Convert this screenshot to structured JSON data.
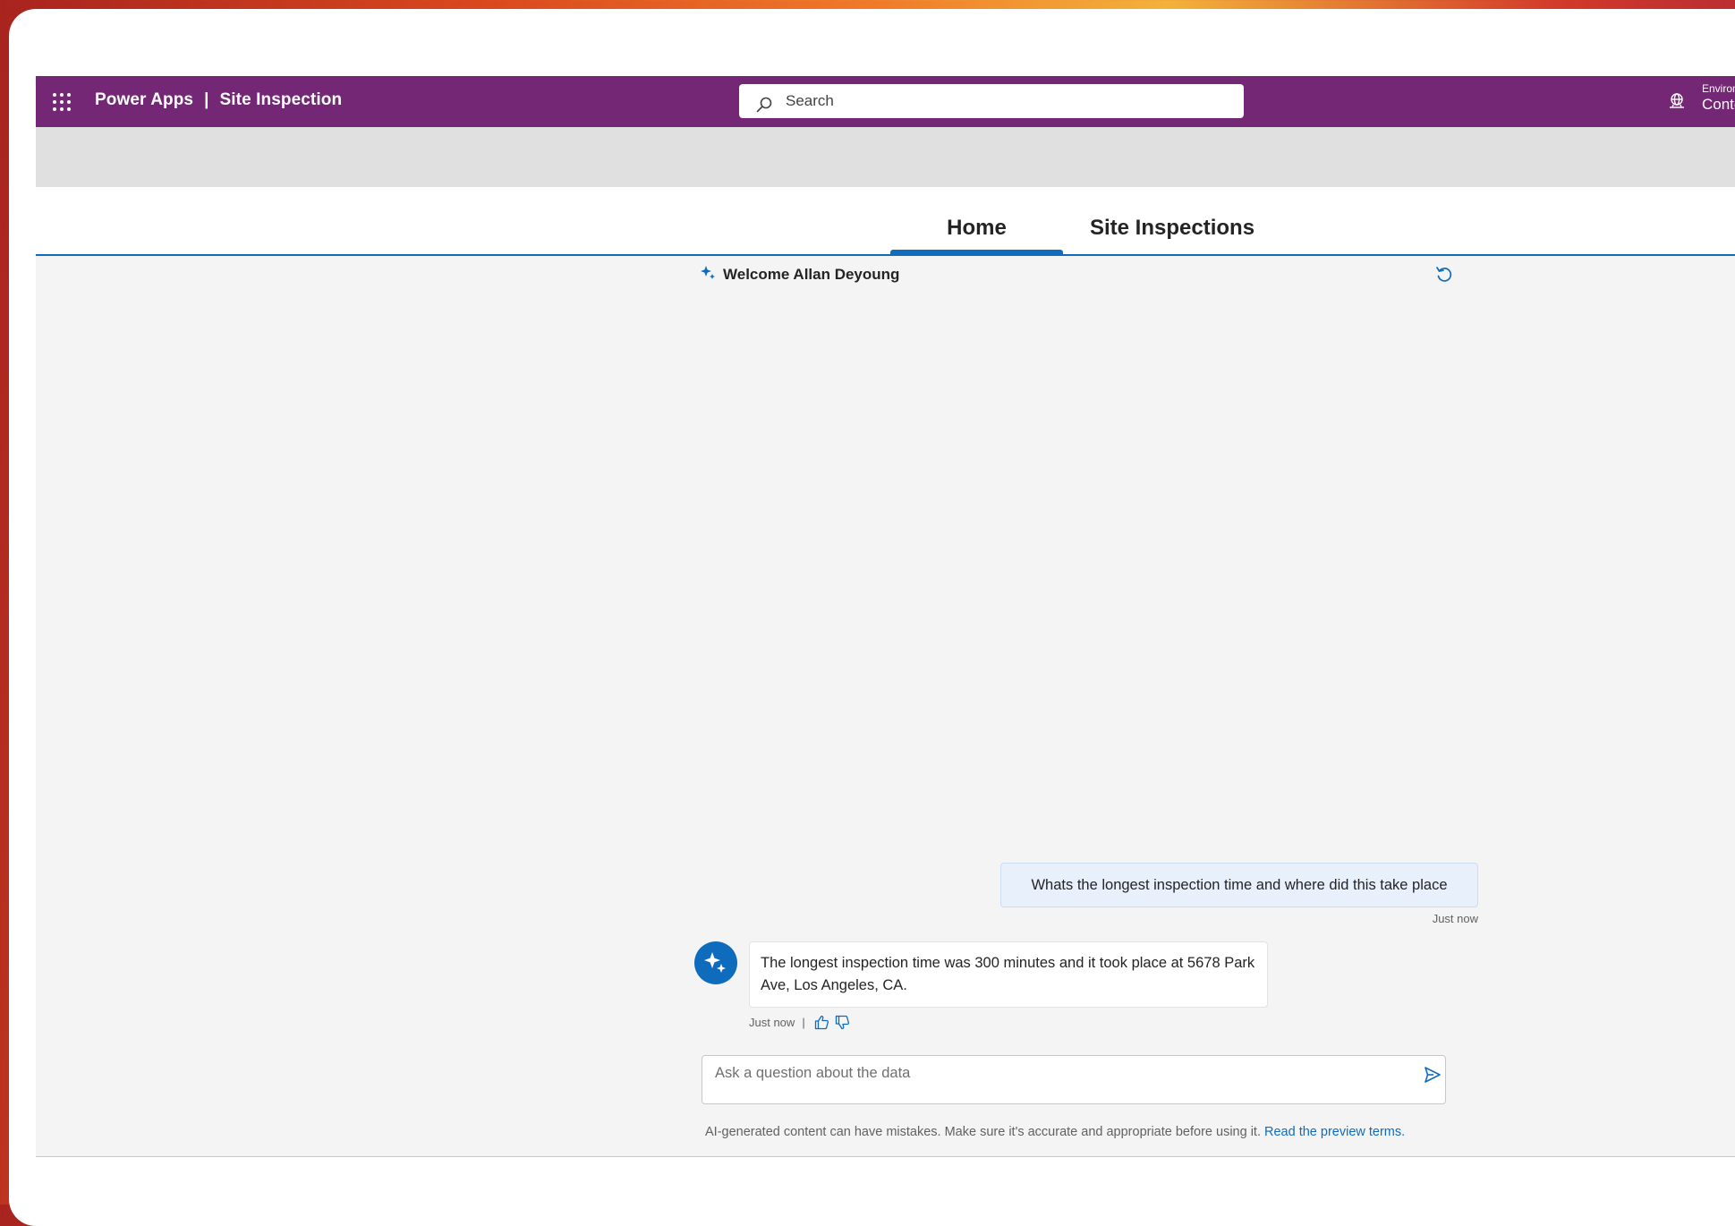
{
  "header": {
    "product": "Power Apps",
    "separator": "|",
    "app_name": "Site Inspection",
    "search_placeholder": "Search",
    "environment_label": "Environ",
    "environment_value": "Conto",
    "icons": {
      "app_launcher": "waffle-icon",
      "search": "search-icon",
      "environment": "environment-icon"
    }
  },
  "tabs": [
    {
      "label": "Home",
      "selected": true
    },
    {
      "label": "Site Inspections",
      "selected": false
    }
  ],
  "copilot": {
    "welcome": "Welcome Allan Deyoung",
    "icons": {
      "welcome": "sparkle-icon",
      "refresh": "refresh-icon",
      "avatar": "copilot-icon",
      "send": "send-icon"
    },
    "messages": [
      {
        "role": "user",
        "text": "Whats the longest inspection time and where did this take place",
        "time": "Just now"
      },
      {
        "role": "assistant",
        "text": "The longest inspection time was 300 minutes and it took place at 5678 Park Ave, Los Angeles, CA.",
        "time": "Just now",
        "separator": "|"
      }
    ],
    "input_placeholder": "Ask a question about the data",
    "disclaimer": "AI-generated content can have mistakes. Make sure it's accurate and appropriate before using it.",
    "disclaimer_link": "Read the preview terms."
  },
  "colors": {
    "header_bg": "#742774",
    "accent": "#0f6cbd",
    "user_bubble": "#e8f0fb",
    "canvas_bg": "#f4f4f4"
  }
}
